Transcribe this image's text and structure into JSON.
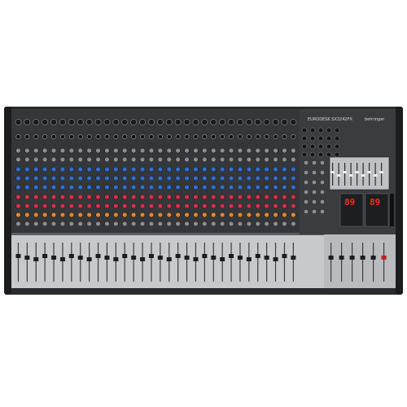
{
  "product": {
    "brand": "behringer",
    "model": "EURODESK SX3242FX",
    "description": "32-input mixing console with 32 channel strips, master section, graphic EQ and dual effects processors"
  },
  "channel_count": 32,
  "effects_displays": [
    "89",
    "89"
  ],
  "colors": {
    "background": "#ffffff",
    "chassis": "#2a2b2e",
    "upper_panel": "#34363a",
    "fader_section": "#c7c9cc",
    "knob_blue": "#2f6fd1",
    "knob_red": "#d8304a",
    "knob_orange": "#e0862a",
    "knob_grey": "#8a8d92",
    "led_display": "#ff2a1a"
  },
  "icons": [
    "xlr-input-icon",
    "jack-input-icon",
    "rotary-knob-icon",
    "fader-icon",
    "led-display-icon",
    "graphic-eq-icon"
  ]
}
